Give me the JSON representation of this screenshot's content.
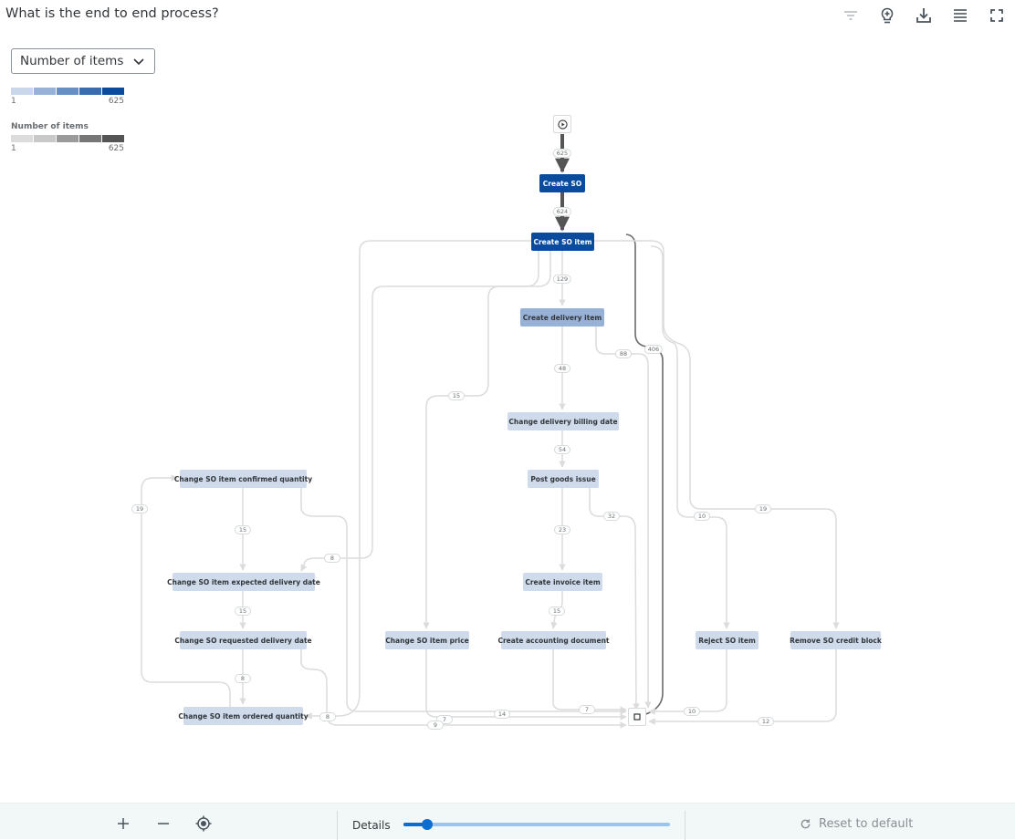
{
  "header": {
    "title": "What is the end to end process?",
    "toolbar": [
      {
        "name": "filter-icon",
        "label": "Filter"
      },
      {
        "name": "lightbulb-icon",
        "label": "Insights"
      },
      {
        "name": "download-icon",
        "label": "Download"
      },
      {
        "name": "menu-icon",
        "label": "Menu"
      },
      {
        "name": "fullscreen-icon",
        "label": "Fullscreen"
      }
    ]
  },
  "measure_select": {
    "value": "Number of items"
  },
  "legends": [
    {
      "title": "",
      "min": "1",
      "max": "625",
      "colors": [
        "#cad6e9",
        "#98b1d6",
        "#6690c4",
        "#3a6cb0",
        "#0a4b9e"
      ]
    },
    {
      "title": "Number of items",
      "min": "1",
      "max": "625",
      "colors": [
        "#dcdcdc",
        "#c8c8c8",
        "#9a9a9a",
        "#777777",
        "#555555"
      ]
    }
  ],
  "diagram": {
    "start_label": "Start",
    "end_label": "End",
    "nodes": [
      {
        "id": "create_so",
        "label": "Create SO",
        "value_level": "high"
      },
      {
        "id": "create_so_item",
        "label": "Create SO item",
        "value_level": "high"
      },
      {
        "id": "create_delivery_item",
        "label": "Create delivery item",
        "value_level": "mid"
      },
      {
        "id": "change_delivery_billing_date",
        "label": "Change delivery billing date",
        "value_level": "low"
      },
      {
        "id": "post_goods_issue",
        "label": "Post goods issue",
        "value_level": "low"
      },
      {
        "id": "create_invoice_item",
        "label": "Create invoice item",
        "value_level": "low"
      },
      {
        "id": "create_accounting_document",
        "label": "Create accounting document",
        "value_level": "low"
      },
      {
        "id": "change_so_item_confirmed_quantity",
        "label": "Change SO item confirmed quantity",
        "value_level": "low"
      },
      {
        "id": "change_so_item_expected_delivery_date",
        "label": "Change SO item expected delivery date",
        "value_level": "low"
      },
      {
        "id": "change_so_requested_delivery_date",
        "label": "Change SO requested delivery date",
        "value_level": "low"
      },
      {
        "id": "change_so_item_ordered_quantity",
        "label": "Change SO item ordered quantity",
        "value_level": "low"
      },
      {
        "id": "change_so_item_price",
        "label": "Change SO item price",
        "value_level": "low"
      },
      {
        "id": "reject_so_item",
        "label": "Reject SO item",
        "value_level": "low"
      },
      {
        "id": "remove_so_credit_block",
        "label": "Remove SO credit block",
        "value_level": "low"
      }
    ],
    "edges": [
      {
        "from": "start",
        "to": "create_so",
        "label": "625"
      },
      {
        "from": "create_so",
        "to": "create_so_item",
        "label": "624"
      },
      {
        "from": "create_so_item",
        "to": "create_delivery_item",
        "label": "129"
      },
      {
        "from": "create_so_item",
        "to": "end",
        "label": "406"
      },
      {
        "from": "create_delivery_item",
        "to": "change_delivery_billing_date",
        "label": "48"
      },
      {
        "from": "create_delivery_item",
        "to": "end",
        "label": "88"
      },
      {
        "from": "create_so_item",
        "to": "change_so_item_price",
        "label": "15"
      },
      {
        "from": "change_delivery_billing_date",
        "to": "post_goods_issue",
        "label": "54"
      },
      {
        "from": "post_goods_issue",
        "to": "create_invoice_item",
        "label": "23"
      },
      {
        "from": "post_goods_issue",
        "to": "end",
        "label": "32"
      },
      {
        "from": "create_invoice_item",
        "to": "create_accounting_document",
        "label": "15"
      },
      {
        "from": "create_so_item",
        "to": "reject_so_item",
        "label": "10"
      },
      {
        "from": "create_so_item",
        "to": "remove_so_credit_block",
        "label": "19"
      },
      {
        "from": "change_so_item_ordered_quantity",
        "to": "change_so_item_confirmed_quantity",
        "label": "19"
      },
      {
        "from": "change_so_item_confirmed_quantity",
        "to": "change_so_item_expected_delivery_date",
        "label": "15"
      },
      {
        "from": "create_so_item",
        "to": "change_so_item_expected_delivery_date",
        "label": "8"
      },
      {
        "from": "change_so_item_expected_delivery_date",
        "to": "change_so_requested_delivery_date",
        "label": "15"
      },
      {
        "from": "change_so_requested_delivery_date",
        "to": "change_so_item_ordered_quantity",
        "label": "8"
      },
      {
        "from": "create_so_item",
        "to": "change_so_item_ordered_quantity",
        "label": "8"
      },
      {
        "from": "change_so_item_price",
        "to": "end",
        "label": "7"
      },
      {
        "from": "change_so_requested_delivery_date",
        "to": "end",
        "label": "9"
      },
      {
        "from": "change_so_item_confirmed_quantity",
        "to": "end",
        "label": "14"
      },
      {
        "from": "create_accounting_document",
        "to": "end",
        "label": "7"
      },
      {
        "from": "reject_so_item",
        "to": "end",
        "label": "10"
      },
      {
        "from": "remove_so_credit_block",
        "to": "end",
        "label": "12"
      }
    ]
  },
  "footer": {
    "zoom_in": "+",
    "zoom_out": "−",
    "details_label": "Details",
    "details_value": 0.09,
    "reset_label": "Reset to default"
  }
}
